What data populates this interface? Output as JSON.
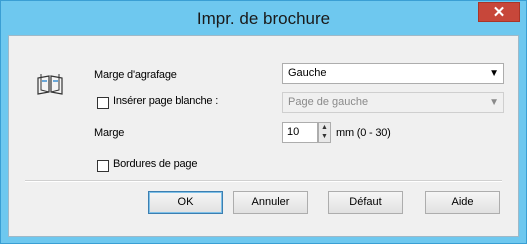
{
  "window": {
    "title": "Impr. de brochure",
    "close_symbol": "✕"
  },
  "fields": {
    "binding_margin": {
      "label": "Marge d'agrafage",
      "value": "Gauche"
    },
    "insert_blank": {
      "label": "Insérer page blanche :",
      "checked": false,
      "value": "Page de gauche"
    },
    "margin": {
      "label": "Marge",
      "value": "10",
      "unit": "mm (0 - 30)"
    },
    "page_borders": {
      "label": "Bordures de page",
      "checked": false
    }
  },
  "buttons": {
    "ok": "OK",
    "cancel": "Annuler",
    "default": "Défaut",
    "help": "Aide"
  },
  "icons": {
    "booklet": "booklet-icon",
    "dropdown": "chevron-down-icon"
  }
}
